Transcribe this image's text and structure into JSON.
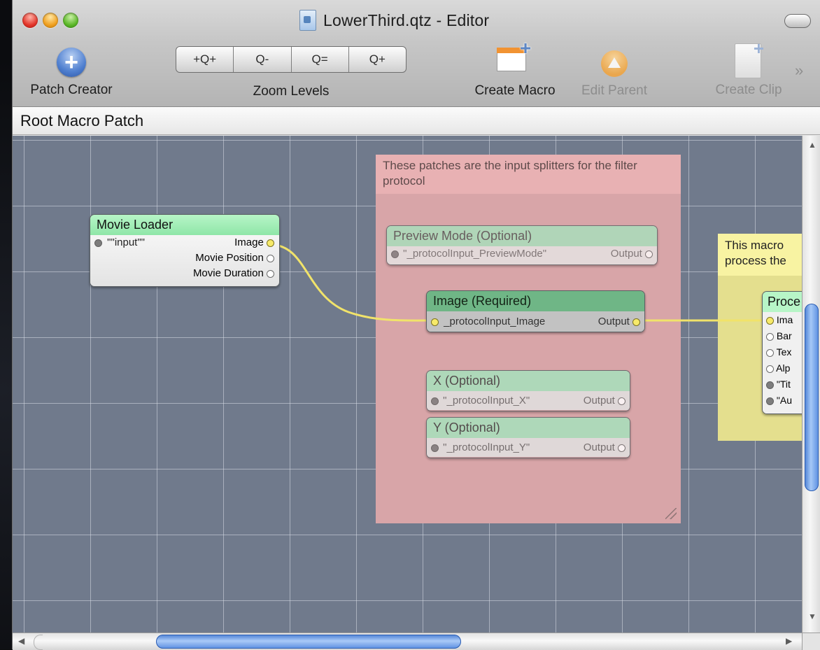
{
  "window": {
    "title": "LowerThird.qtz - Editor"
  },
  "toolbar": {
    "patch_creator": "Patch Creator",
    "zoom_levels": "Zoom Levels",
    "create_macro": "Create Macro",
    "edit_parent": "Edit Parent",
    "create_clip": "Create Clip",
    "zoom_buttons": [
      "+Q+",
      "Q-",
      "Q=",
      "Q+"
    ]
  },
  "breadcrumb": "Root Macro Patch",
  "notes": {
    "pink": "These patches are the input splitters for the filter protocol",
    "yellow_line1": "This macro",
    "yellow_line2": "process the"
  },
  "patches": {
    "movie_loader": {
      "title": "Movie Loader",
      "input": "\"\"input\"\"",
      "outputs": [
        "Image",
        "Movie Position",
        "Movie Duration"
      ]
    },
    "preview_mode": {
      "title": "Preview Mode (Optional)",
      "input": "\"_protocolInput_PreviewMode\"",
      "output": "Output"
    },
    "image_required": {
      "title": "Image (Required)",
      "input": "_protocolInput_Image",
      "output": "Output"
    },
    "x_optional": {
      "title": "X (Optional)",
      "input": "\"_protocolInput_X\"",
      "output": "Output"
    },
    "y_optional": {
      "title": "Y (Optional)",
      "input": "\"_protocolInput_Y\"",
      "output": "Output"
    },
    "process": {
      "title": "Proce",
      "ports": [
        "Ima",
        "Bar",
        "Tex",
        "Alp",
        "\"Tit",
        "\"Au"
      ]
    }
  },
  "colors": {
    "canvas": "#707a8c",
    "wire": "#f1e36a",
    "note_pink": "#d8a5a8",
    "note_yellow": "#e4df8e",
    "patch_green": "#b7f5c7"
  },
  "icons": [
    "plus-icon",
    "zoom-icon",
    "macro-icon",
    "parent-icon",
    "clip-icon",
    "chevron-right-icon"
  ]
}
